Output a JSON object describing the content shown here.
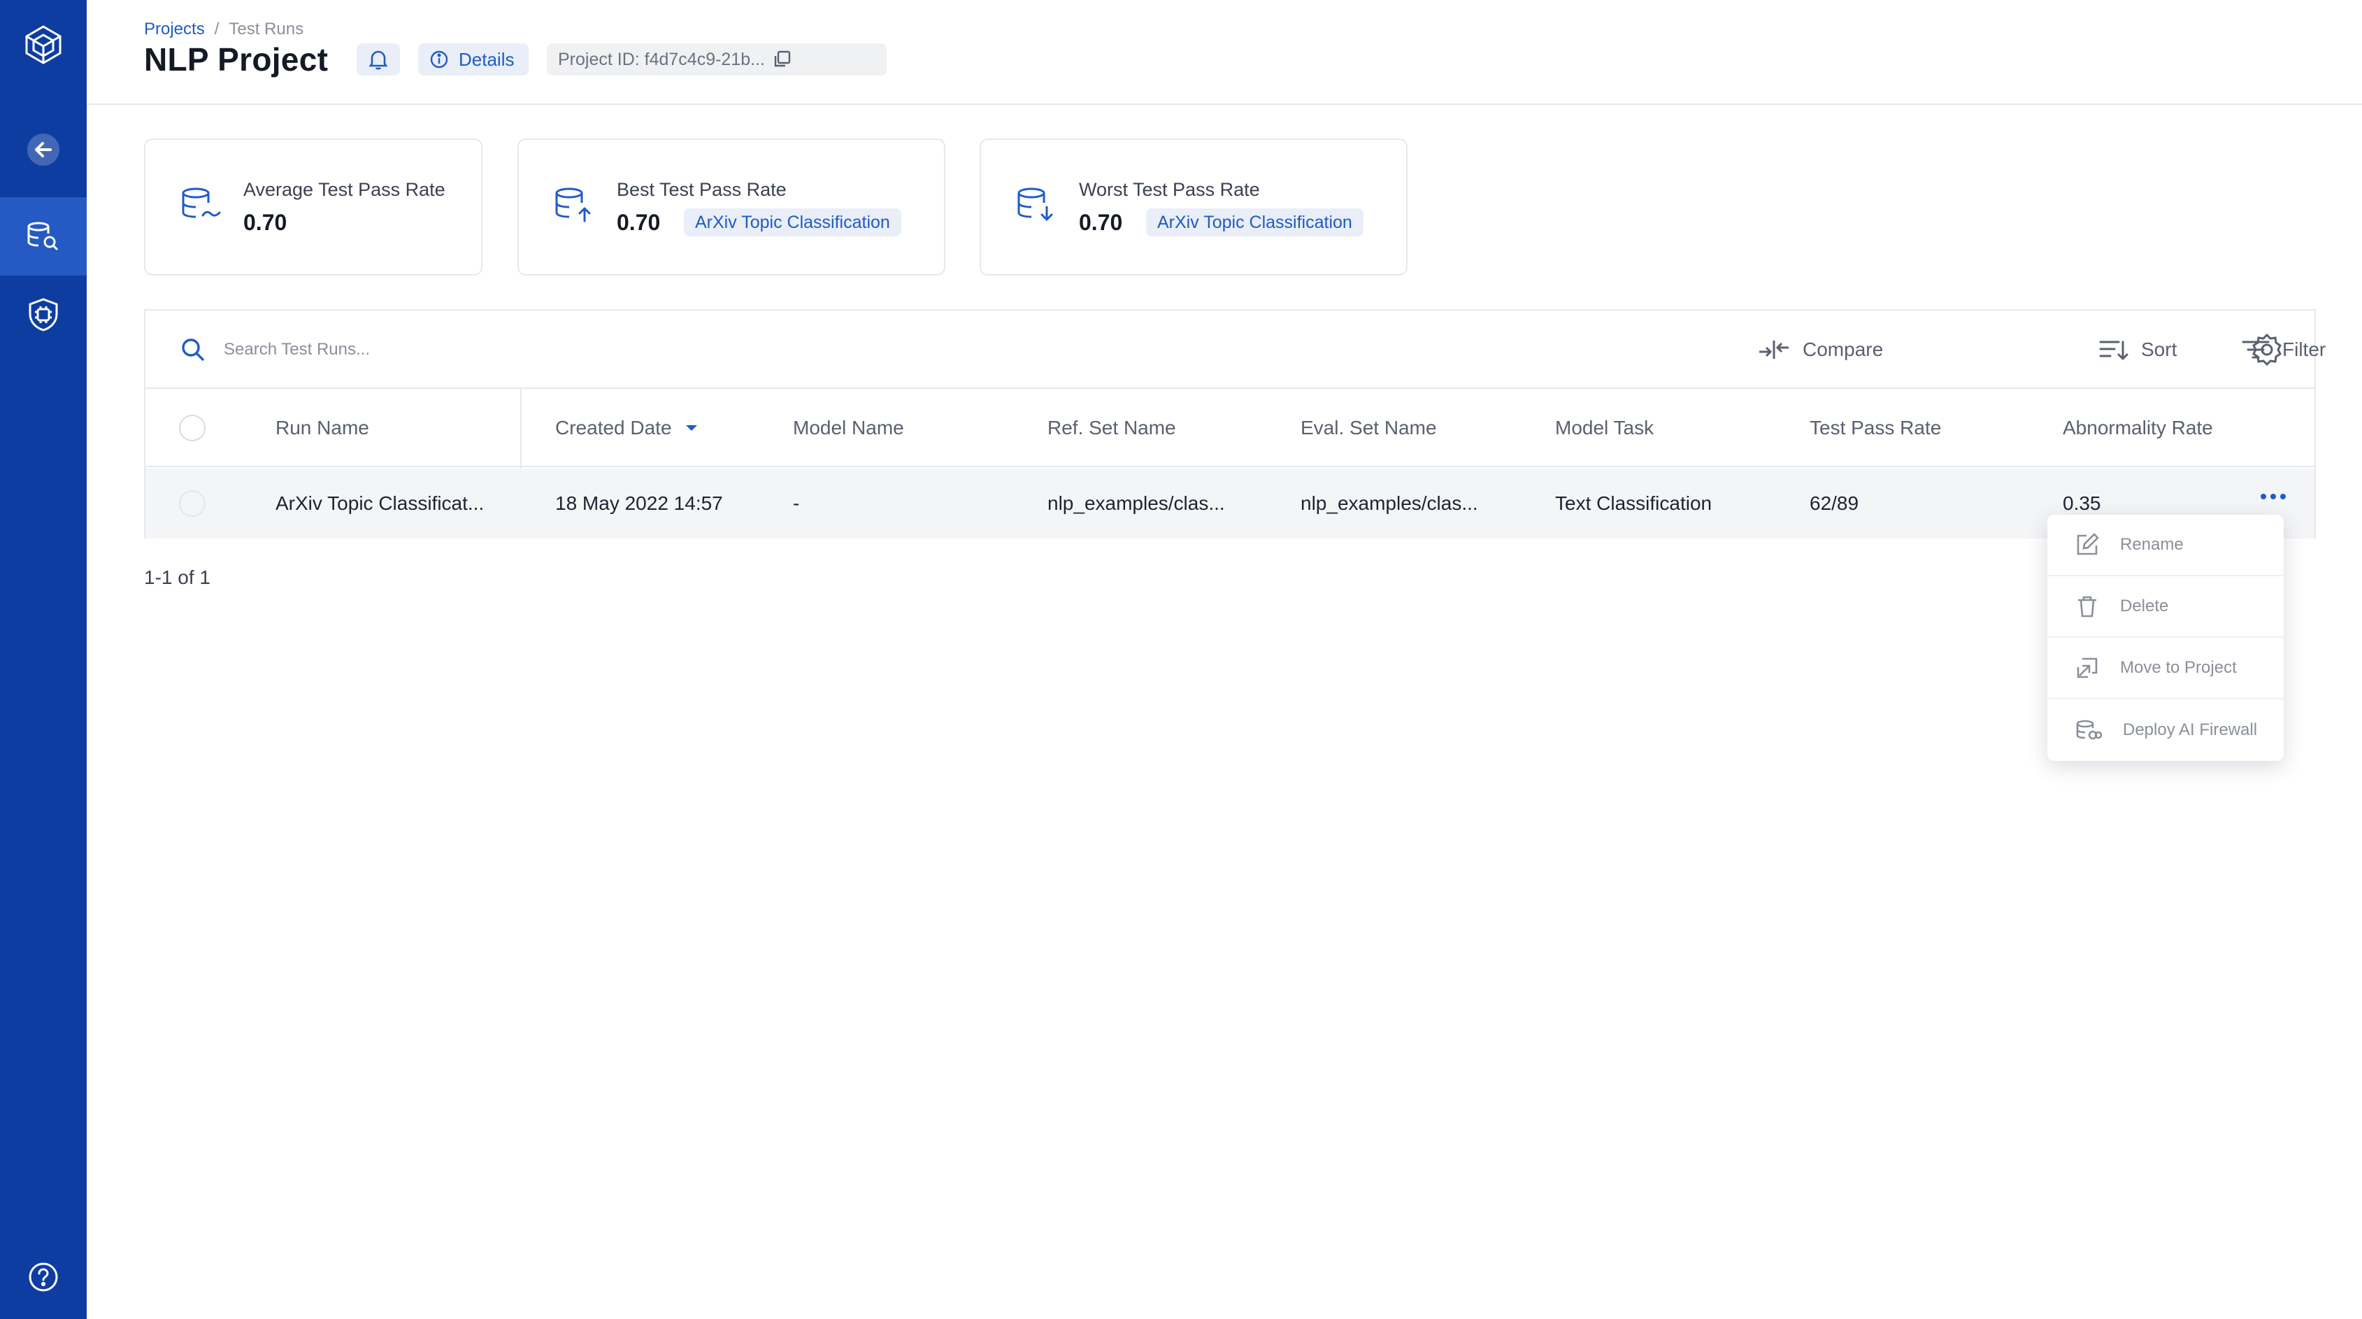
{
  "breadcrumb": {
    "root": "Projects",
    "separator": "/",
    "current": "Test Runs"
  },
  "page_title": "NLP Project",
  "header": {
    "details_label": "Details",
    "project_id": "Project ID: f4d7c4c9-21b..."
  },
  "cards": [
    {
      "label": "Average Test Pass Rate",
      "value": "0.70",
      "tag": ""
    },
    {
      "label": "Best Test Pass Rate",
      "value": "0.70",
      "tag": "ArXiv Topic Classification"
    },
    {
      "label": "Worst Test Pass Rate",
      "value": "0.70",
      "tag": "ArXiv Topic Classification"
    }
  ],
  "toolbar": {
    "search_placeholder": "Search Test Runs...",
    "compare_label": "Compare",
    "sort_label": "Sort",
    "filter_label": "Filter"
  },
  "table": {
    "columns": [
      "Run Name",
      "Created Date",
      "Model Name",
      "Ref. Set Name",
      "Eval. Set Name",
      "Model Task",
      "Test Pass Rate",
      "Abnormality Rate"
    ],
    "rows": [
      [
        "ArXiv Topic Classificat...",
        "18 May 2022 14:57",
        "-",
        "nlp_examples/clas...",
        "nlp_examples/clas...",
        "Text Classification",
        "62/89",
        "0.35"
      ]
    ]
  },
  "pagination": "1-1 of 1",
  "context_menu": [
    "Rename",
    "Delete",
    "Move to Project",
    "Deploy AI Firewall"
  ],
  "colors": {
    "rail": "#0d3da0",
    "accent": "#1f5bc8",
    "badge_bg": "#e9eef8"
  }
}
